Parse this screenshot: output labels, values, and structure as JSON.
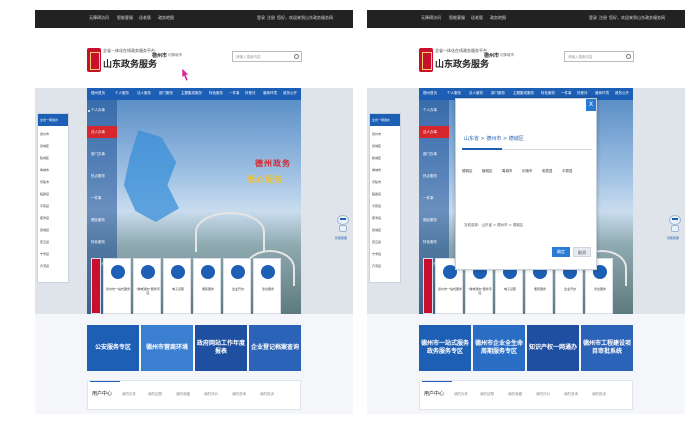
{
  "topbar": {
    "items": [
      "无障碍访问",
      "智能客服",
      "适老版",
      "政务地图",
      "登录",
      "注册",
      "您好，欢迎来到山东政务服务网"
    ]
  },
  "header": {
    "brand_sub": "全省一体化在线政务服务平台",
    "brand_name": "山东政务服务",
    "city": "德州市",
    "switch": "切换城市",
    "search_placeholder": "请输入搜索内容"
  },
  "nav": {
    "items": [
      "德州首页",
      "个人服务",
      "法人服务",
      "部门服务",
      "主题集成服务",
      "特色服务",
      "一件事",
      "好差评",
      "营商环境",
      "政务公开"
    ]
  },
  "hero": {
    "slogan1": "德州政务",
    "slogan2": "暖心服务"
  },
  "side_menu": {
    "items": [
      "个人办事",
      "法人办事",
      "部门办事",
      "热点服务",
      "一件事",
      "便民服务",
      "特色服务",
      "政务公开"
    ]
  },
  "left_card": {
    "title": "全省一网通办",
    "items": [
      "德州市",
      "德城区",
      "陵城区",
      "禹城市",
      "乐陵市",
      "临邑县",
      "平原县",
      "夏津县",
      "武城县",
      "庆云县",
      "宁津县",
      "齐河县"
    ]
  },
  "services_left": [
    "德州市一站式服务",
    "\"跨域通办\"服务专区",
    "电子证照",
    "便民服务",
    "企业开办",
    "涉企服务"
  ],
  "services_right": [
    "德州市一站式服务",
    "\"跨域通办\"服务专区",
    "电子证照",
    "便民服务",
    "企业开办",
    "涉企服务"
  ],
  "banners_left": [
    "公安服务专区",
    "德州市营商环境",
    "政府网站工作年度报表",
    "企业登记档案查询"
  ],
  "banners_right": [
    "德州市一站式服务 政务服务专区",
    "德州市企业全生命周期服务专区",
    "知识产权一网通办",
    "德州市工程建设项目审批系统"
  ],
  "tabs": [
    "用户中心",
    "我的办件",
    "我的证照",
    "我的收藏",
    "我的评价",
    "我的咨询",
    "我的投诉"
  ],
  "robot_label": "智能客服",
  "modal": {
    "close": "X",
    "crumb": "山东省 > 德州市 > 德城区",
    "options": [
      "德城区",
      "陵城区",
      "禹城市",
      "乐陵市",
      "临邑县",
      "平原县"
    ],
    "current": "当前选择：山东省 > 德州市 > 德城区",
    "ok": "确定",
    "cancel": "取消"
  }
}
